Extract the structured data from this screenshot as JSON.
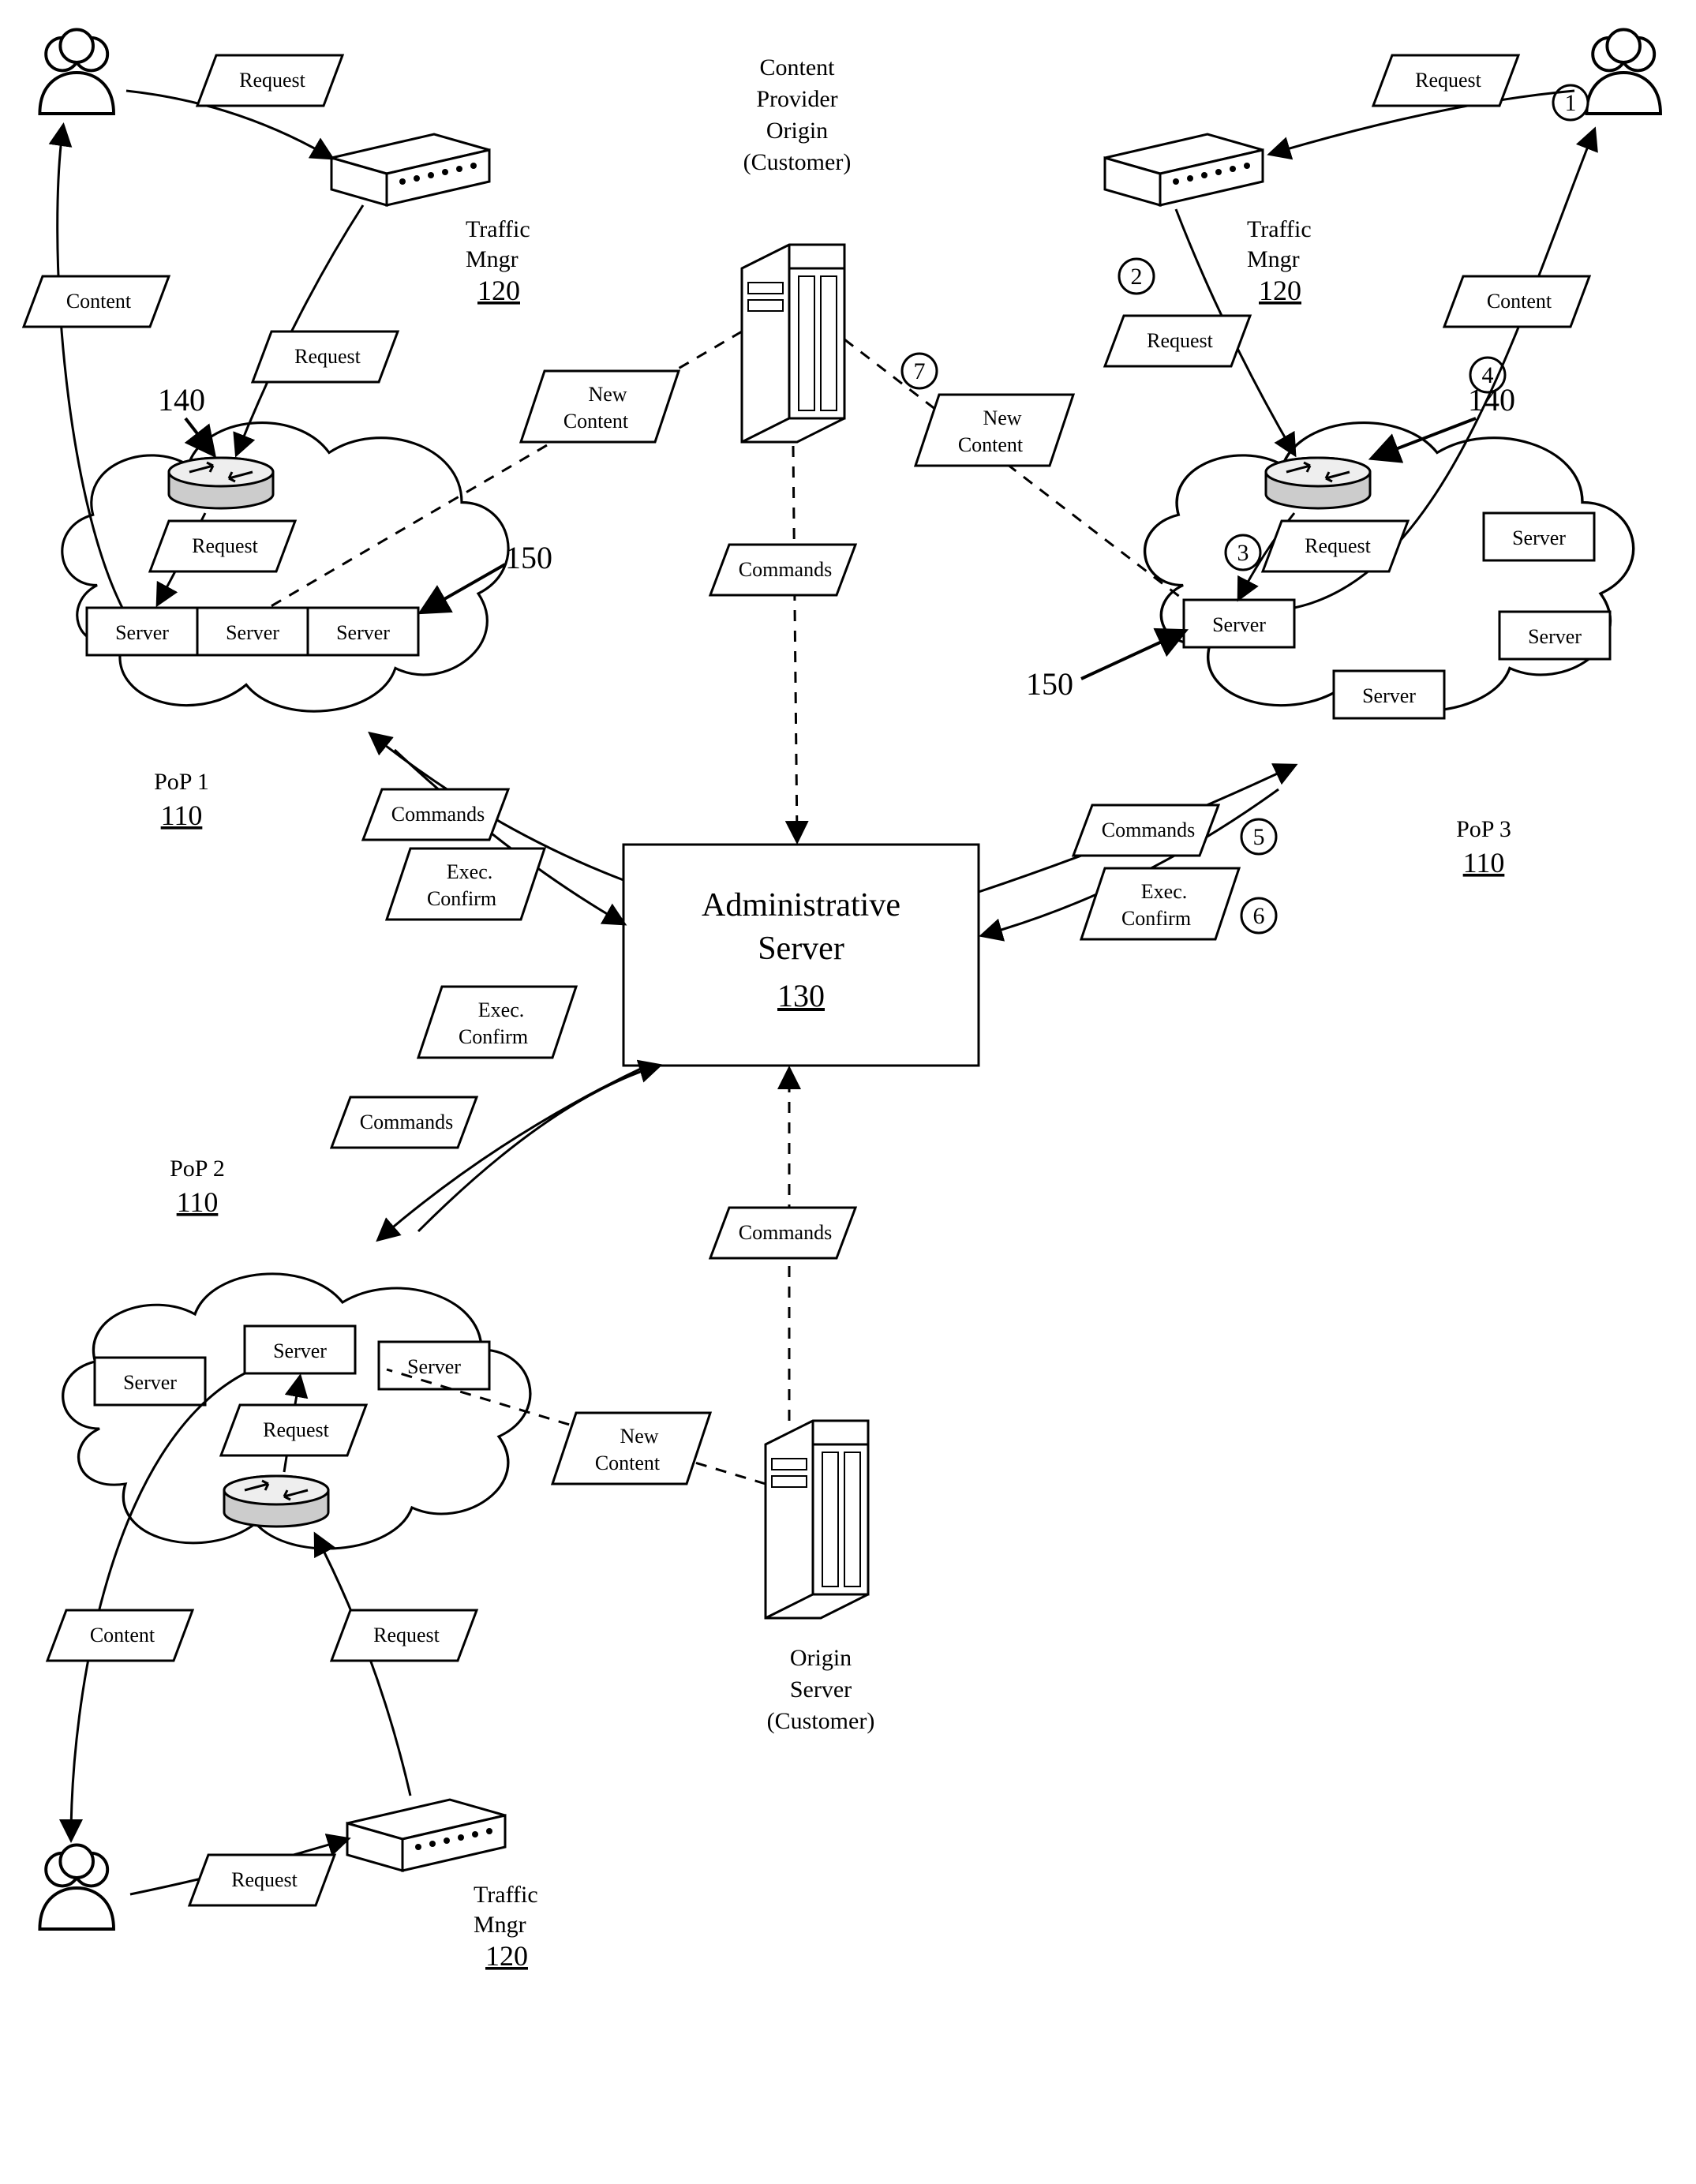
{
  "title_origin_top": {
    "l1": "Content",
    "l2": "Provider",
    "l3": "Origin",
    "l4": "(Customer)"
  },
  "title_origin_bottom": {
    "l1": "Origin",
    "l2": "Server",
    "l3": "(Customer)"
  },
  "admin": {
    "l1": "Administrative",
    "l2": "Server",
    "ref": "130"
  },
  "tm_ref": "120",
  "tm_label": {
    "l1": "Traffic",
    "l2": "Mngr"
  },
  "pop1": {
    "label": "PoP 1",
    "ref": "110"
  },
  "pop2": {
    "label": "PoP 2",
    "ref": "110"
  },
  "pop3": {
    "label": "PoP 3",
    "ref": "110"
  },
  "ref140": "140",
  "ref150": "150",
  "labels": {
    "request": "Request",
    "content": "Content",
    "server": "Server",
    "commands": "Commands",
    "execConfirm1": "Exec.",
    "execConfirm2": "Confirm",
    "newContent1": "New",
    "newContent2": "Content"
  },
  "step_numbers": [
    "1",
    "2",
    "3",
    "4",
    "5",
    "6",
    "7"
  ]
}
